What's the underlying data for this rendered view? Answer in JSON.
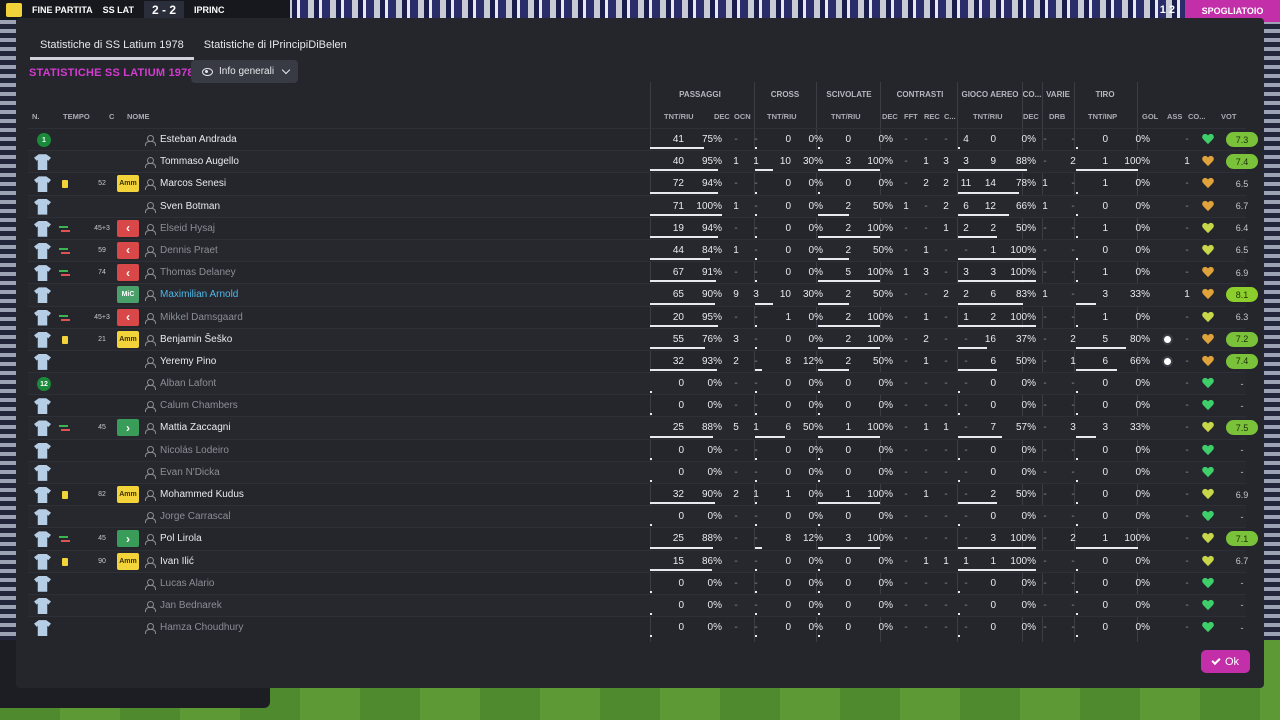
{
  "scorebar": {
    "label": "FINE PARTITA",
    "home": "SS LAT",
    "score": "2 - 2",
    "away": "IPRINC"
  },
  "top_right": {
    "label": "SPOGLIATOIO",
    "clock": "1 2"
  },
  "tabs": [
    {
      "label": "Statistiche di SS Latium 1978",
      "active": true
    },
    {
      "label": "Statistiche di IPrincipiDiBelen",
      "active": false
    }
  ],
  "title": "STATISTICHE SS LATIUM 1978",
  "view_dropdown": "Info generali",
  "groups": [
    "PASSAGGI",
    "CROSS",
    "SCIVOLATE",
    "CONTRASTI",
    "GIOCO AEREO",
    "CO...",
    "VARIE",
    "TIRO"
  ],
  "columns": [
    "N.",
    "TEMPO",
    "C",
    "NOME",
    "TNT/RIU",
    "DEC",
    "OCN",
    "TNT/RIU",
    "TNT/RIU",
    "DEC",
    "FFT",
    "REC",
    "C...",
    "TNT/RIU",
    "DEC",
    "DRB",
    "TNT/INP",
    "GOL",
    "ASS",
    "CO...",
    "VOT"
  ],
  "ok_label": "Ok",
  "players": [
    {
      "shirt": "gk",
      "num": "1",
      "card": "",
      "swap": "",
      "min": "",
      "badge": "",
      "name": "Esteban Andrada",
      "style": "",
      "p": [
        "41",
        "75%"
      ],
      "pbar": 75,
      "pdec": "-",
      "pocn": "-",
      "cr": [
        "0",
        "0%"
      ],
      "crbar": 0,
      "sc": [
        "0",
        "0%"
      ],
      "scbar": 0,
      "ct": [
        "-",
        "-",
        "-",
        "4"
      ],
      "ae": [
        "0",
        "0%"
      ],
      "aebar": 0,
      "co": "-",
      "drb": "-",
      "ti": [
        "0",
        "0%"
      ],
      "tibar": 0,
      "gol": "",
      "ass": "-",
      "mood": "hg",
      "vot": "7.3",
      "vstyle": "r-lime"
    },
    {
      "shirt": "out",
      "num": "",
      "card": "",
      "swap": "",
      "min": "",
      "badge": "",
      "name": "Tommaso Augello",
      "style": "",
      "p": [
        "40",
        "95%"
      ],
      "pbar": 95,
      "pdec": "1",
      "pocn": "1",
      "cr": [
        "10",
        "30%"
      ],
      "crbar": 30,
      "sc": [
        "3",
        "100%"
      ],
      "scbar": 100,
      "ct": [
        "-",
        "1",
        "3",
        "3"
      ],
      "ae": [
        "9",
        "88%"
      ],
      "aebar": 88,
      "co": "-",
      "drb": "2",
      "ti": [
        "1",
        "100%"
      ],
      "tibar": 100,
      "gol": "",
      "ass": "1",
      "mood": "ho",
      "vot": "7.4",
      "vstyle": "r-lime"
    },
    {
      "shirt": "out",
      "num": "",
      "card": "y",
      "swap": "",
      "min": "52",
      "badge": "Amm",
      "name": "Marcos Senesi",
      "style": "",
      "p": [
        "72",
        "94%"
      ],
      "pbar": 94,
      "pdec": "-",
      "pocn": "-",
      "cr": [
        "0",
        "0%"
      ],
      "crbar": 0,
      "sc": [
        "0",
        "0%"
      ],
      "scbar": 0,
      "ct": [
        "-",
        "2",
        "2",
        "11"
      ],
      "ae": [
        "14",
        "78%"
      ],
      "aebar": 78,
      "co": "1",
      "drb": "-",
      "ti": [
        "1",
        "0%"
      ],
      "tibar": 0,
      "gol": "",
      "ass": "-",
      "mood": "ho",
      "vot": "6.5",
      "vstyle": "r-plain"
    },
    {
      "shirt": "out",
      "num": "",
      "card": "",
      "swap": "",
      "min": "",
      "badge": "",
      "name": "Sven Botman",
      "style": "",
      "p": [
        "71",
        "100%"
      ],
      "pbar": 100,
      "pdec": "1",
      "pocn": "-",
      "cr": [
        "0",
        "0%"
      ],
      "crbar": 0,
      "sc": [
        "2",
        "50%"
      ],
      "scbar": 50,
      "ct": [
        "1",
        "-",
        "2",
        "6"
      ],
      "ae": [
        "12",
        "66%"
      ],
      "aebar": 66,
      "co": "1",
      "drb": "-",
      "ti": [
        "0",
        "0%"
      ],
      "tibar": 0,
      "gol": "",
      "ass": "-",
      "mood": "ho",
      "vot": "6.7",
      "vstyle": "r-plain"
    },
    {
      "shirt": "out",
      "num": "",
      "card": "",
      "swap": "out",
      "min": "45+3",
      "badge": "out",
      "name": "Elseid Hysaj",
      "style": "unused",
      "p": [
        "19",
        "94%"
      ],
      "pbar": 94,
      "pdec": "-",
      "pocn": "-",
      "cr": [
        "0",
        "0%"
      ],
      "crbar": 0,
      "sc": [
        "2",
        "100%"
      ],
      "scbar": 100,
      "ct": [
        "-",
        "-",
        "1",
        "2"
      ],
      "ae": [
        "2",
        "50%"
      ],
      "aebar": 50,
      "co": "-",
      "drb": "-",
      "ti": [
        "1",
        "0%"
      ],
      "tibar": 0,
      "gol": "",
      "ass": "-",
      "mood": "hy",
      "vot": "6.4",
      "vstyle": "r-plain"
    },
    {
      "shirt": "out",
      "num": "",
      "card": "",
      "swap": "out",
      "min": "59",
      "badge": "out",
      "name": "Dennis Praet",
      "style": "unused",
      "p": [
        "44",
        "84%"
      ],
      "pbar": 84,
      "pdec": "1",
      "pocn": "-",
      "cr": [
        "0",
        "0%"
      ],
      "crbar": 0,
      "sc": [
        "2",
        "50%"
      ],
      "scbar": 50,
      "ct": [
        "-",
        "1",
        "-",
        "-"
      ],
      "ae": [
        "1",
        "100%"
      ],
      "aebar": 100,
      "co": "-",
      "drb": "-",
      "ti": [
        "0",
        "0%"
      ],
      "tibar": 0,
      "gol": "",
      "ass": "-",
      "mood": "hy",
      "vot": "6.5",
      "vstyle": "r-plain"
    },
    {
      "shirt": "out",
      "num": "",
      "card": "",
      "swap": "out",
      "min": "74",
      "badge": "out",
      "name": "Thomas Delaney",
      "style": "unused",
      "p": [
        "67",
        "91%"
      ],
      "pbar": 91,
      "pdec": "-",
      "pocn": "-",
      "cr": [
        "0",
        "0%"
      ],
      "crbar": 0,
      "sc": [
        "5",
        "100%"
      ],
      "scbar": 100,
      "ct": [
        "1",
        "3",
        "-",
        "3"
      ],
      "ae": [
        "3",
        "100%"
      ],
      "aebar": 100,
      "co": "-",
      "drb": "-",
      "ti": [
        "1",
        "0%"
      ],
      "tibar": 0,
      "gol": "",
      "ass": "-",
      "mood": "ho",
      "vot": "6.9",
      "vstyle": "r-plain"
    },
    {
      "shirt": "out",
      "num": "",
      "card": "",
      "swap": "",
      "min": "",
      "badge": "MiC",
      "name": "Maximilian Arnold",
      "style": "hl",
      "p": [
        "65",
        "90%"
      ],
      "pbar": 90,
      "pdec": "9",
      "pocn": "3",
      "cr": [
        "10",
        "30%"
      ],
      "crbar": 30,
      "sc": [
        "2",
        "50%"
      ],
      "scbar": 50,
      "ct": [
        "-",
        "-",
        "2",
        "2"
      ],
      "ae": [
        "6",
        "83%"
      ],
      "aebar": 83,
      "co": "1",
      "drb": "-",
      "ti": [
        "3",
        "33%"
      ],
      "tibar": 33,
      "gol": "",
      "ass": "1",
      "mood": "ho",
      "vot": "8.1",
      "vstyle": "r-green"
    },
    {
      "shirt": "out",
      "num": "",
      "card": "",
      "swap": "out",
      "min": "45+3",
      "badge": "out",
      "name": "Mikkel Damsgaard",
      "style": "unused",
      "p": [
        "20",
        "95%"
      ],
      "pbar": 95,
      "pdec": "-",
      "pocn": "-",
      "cr": [
        "1",
        "0%"
      ],
      "crbar": 0,
      "sc": [
        "2",
        "100%"
      ],
      "scbar": 100,
      "ct": [
        "-",
        "1",
        "-",
        "1"
      ],
      "ae": [
        "2",
        "100%"
      ],
      "aebar": 100,
      "co": "-",
      "drb": "-",
      "ti": [
        "1",
        "0%"
      ],
      "tibar": 0,
      "gol": "",
      "ass": "-",
      "mood": "hy",
      "vot": "6.3",
      "vstyle": "r-plain"
    },
    {
      "shirt": "out",
      "num": "",
      "card": "y",
      "swap": "",
      "min": "21",
      "badge": "Amm",
      "name": "Benjamin Šeško",
      "style": "",
      "p": [
        "55",
        "76%"
      ],
      "pbar": 76,
      "pdec": "3",
      "pocn": "-",
      "cr": [
        "0",
        "0%"
      ],
      "crbar": 0,
      "sc": [
        "2",
        "100%"
      ],
      "scbar": 100,
      "ct": [
        "-",
        "2",
        "-",
        "-"
      ],
      "ae": [
        "16",
        "37%"
      ],
      "aebar": 37,
      "co": "-",
      "drb": "2",
      "ti": [
        "5",
        "80%"
      ],
      "tibar": 80,
      "gol": "ball",
      "ass": "-",
      "mood": "ho",
      "vot": "7.2",
      "vstyle": "r-lime"
    },
    {
      "shirt": "out",
      "num": "",
      "card": "",
      "swap": "",
      "min": "",
      "badge": "",
      "name": "Yeremy Pino",
      "style": "",
      "p": [
        "32",
        "93%"
      ],
      "pbar": 93,
      "pdec": "2",
      "pocn": "-",
      "cr": [
        "8",
        "12%"
      ],
      "crbar": 12,
      "sc": [
        "2",
        "50%"
      ],
      "scbar": 50,
      "ct": [
        "-",
        "1",
        "-",
        "-"
      ],
      "ae": [
        "6",
        "50%"
      ],
      "aebar": 50,
      "co": "-",
      "drb": "1",
      "ti": [
        "6",
        "66%"
      ],
      "tibar": 66,
      "gol": "ball",
      "ass": "-",
      "mood": "ho",
      "vot": "7.4",
      "vstyle": "r-lime"
    },
    {
      "shirt": "gk",
      "num": "12",
      "card": "",
      "swap": "",
      "min": "",
      "badge": "",
      "name": "Alban Lafont",
      "style": "unused",
      "p": [
        "0",
        "0%"
      ],
      "pbar": 0,
      "pdec": "-",
      "pocn": "-",
      "cr": [
        "0",
        "0%"
      ],
      "crbar": 0,
      "sc": [
        "0",
        "0%"
      ],
      "scbar": 0,
      "ct": [
        "-",
        "-",
        "-",
        "-"
      ],
      "ae": [
        "0",
        "0%"
      ],
      "aebar": 0,
      "co": "-",
      "drb": "-",
      "ti": [
        "0",
        "0%"
      ],
      "tibar": 0,
      "gol": "",
      "ass": "-",
      "mood": "hg",
      "vot": "-",
      "vstyle": "r-plain"
    },
    {
      "shirt": "out",
      "num": "",
      "card": "",
      "swap": "",
      "min": "",
      "badge": "",
      "name": "Calum Chambers",
      "style": "unused",
      "p": [
        "0",
        "0%"
      ],
      "pbar": 0,
      "pdec": "-",
      "pocn": "-",
      "cr": [
        "0",
        "0%"
      ],
      "crbar": 0,
      "sc": [
        "0",
        "0%"
      ],
      "scbar": 0,
      "ct": [
        "-",
        "-",
        "-",
        "-"
      ],
      "ae": [
        "0",
        "0%"
      ],
      "aebar": 0,
      "co": "-",
      "drb": "-",
      "ti": [
        "0",
        "0%"
      ],
      "tibar": 0,
      "gol": "",
      "ass": "-",
      "mood": "hg",
      "vot": "-",
      "vstyle": "r-plain"
    },
    {
      "shirt": "out",
      "num": "",
      "card": "",
      "swap": "in",
      "min": "45",
      "badge": "in",
      "name": "Mattia Zaccagni",
      "style": "",
      "p": [
        "25",
        "88%"
      ],
      "pbar": 88,
      "pdec": "5",
      "pocn": "1",
      "cr": [
        "6",
        "50%"
      ],
      "crbar": 50,
      "sc": [
        "1",
        "100%"
      ],
      "scbar": 100,
      "ct": [
        "-",
        "1",
        "1",
        "-"
      ],
      "ae": [
        "7",
        "57%"
      ],
      "aebar": 57,
      "co": "-",
      "drb": "3",
      "ti": [
        "3",
        "33%"
      ],
      "tibar": 33,
      "gol": "",
      "ass": "-",
      "mood": "hy",
      "vot": "7.5",
      "vstyle": "r-lime"
    },
    {
      "shirt": "out",
      "num": "",
      "card": "",
      "swap": "",
      "min": "",
      "badge": "",
      "name": "Nicolás Lodeiro",
      "style": "unused",
      "p": [
        "0",
        "0%"
      ],
      "pbar": 0,
      "pdec": "-",
      "pocn": "-",
      "cr": [
        "0",
        "0%"
      ],
      "crbar": 0,
      "sc": [
        "0",
        "0%"
      ],
      "scbar": 0,
      "ct": [
        "-",
        "-",
        "-",
        "-"
      ],
      "ae": [
        "0",
        "0%"
      ],
      "aebar": 0,
      "co": "-",
      "drb": "-",
      "ti": [
        "0",
        "0%"
      ],
      "tibar": 0,
      "gol": "",
      "ass": "-",
      "mood": "hg",
      "vot": "-",
      "vstyle": "r-plain"
    },
    {
      "shirt": "out",
      "num": "",
      "card": "",
      "swap": "",
      "min": "",
      "badge": "",
      "name": "Evan N'Dicka",
      "style": "unused",
      "p": [
        "0",
        "0%"
      ],
      "pbar": 0,
      "pdec": "-",
      "pocn": "-",
      "cr": [
        "0",
        "0%"
      ],
      "crbar": 0,
      "sc": [
        "0",
        "0%"
      ],
      "scbar": 0,
      "ct": [
        "-",
        "-",
        "-",
        "-"
      ],
      "ae": [
        "0",
        "0%"
      ],
      "aebar": 0,
      "co": "-",
      "drb": "-",
      "ti": [
        "0",
        "0%"
      ],
      "tibar": 0,
      "gol": "",
      "ass": "-",
      "mood": "hg",
      "vot": "-",
      "vstyle": "r-plain"
    },
    {
      "shirt": "out",
      "num": "",
      "card": "y",
      "swap": "",
      "min": "82",
      "badge": "Amm",
      "name": "Mohammed Kudus",
      "style": "",
      "p": [
        "32",
        "90%"
      ],
      "pbar": 90,
      "pdec": "2",
      "pocn": "1",
      "cr": [
        "1",
        "0%"
      ],
      "crbar": 0,
      "sc": [
        "1",
        "100%"
      ],
      "scbar": 100,
      "ct": [
        "-",
        "1",
        "-",
        "-"
      ],
      "ae": [
        "2",
        "50%"
      ],
      "aebar": 50,
      "co": "-",
      "drb": "-",
      "ti": [
        "0",
        "0%"
      ],
      "tibar": 0,
      "gol": "",
      "ass": "-",
      "mood": "hy",
      "vot": "6.9",
      "vstyle": "r-plain"
    },
    {
      "shirt": "out",
      "num": "",
      "card": "",
      "swap": "",
      "min": "",
      "badge": "",
      "name": "Jorge Carrascal",
      "style": "unused",
      "p": [
        "0",
        "0%"
      ],
      "pbar": 0,
      "pdec": "-",
      "pocn": "-",
      "cr": [
        "0",
        "0%"
      ],
      "crbar": 0,
      "sc": [
        "0",
        "0%"
      ],
      "scbar": 0,
      "ct": [
        "-",
        "-",
        "-",
        "-"
      ],
      "ae": [
        "0",
        "0%"
      ],
      "aebar": 0,
      "co": "-",
      "drb": "-",
      "ti": [
        "0",
        "0%"
      ],
      "tibar": 0,
      "gol": "",
      "ass": "-",
      "mood": "hg",
      "vot": "-",
      "vstyle": "r-plain"
    },
    {
      "shirt": "out",
      "num": "",
      "card": "",
      "swap": "in",
      "min": "45",
      "badge": "in",
      "name": "Pol Lirola",
      "style": "",
      "p": [
        "25",
        "88%"
      ],
      "pbar": 88,
      "pdec": "-",
      "pocn": "-",
      "cr": [
        "8",
        "12%"
      ],
      "crbar": 12,
      "sc": [
        "3",
        "100%"
      ],
      "scbar": 100,
      "ct": [
        "-",
        "-",
        "-",
        "-"
      ],
      "ae": [
        "3",
        "100%"
      ],
      "aebar": 100,
      "co": "-",
      "drb": "2",
      "ti": [
        "1",
        "100%"
      ],
      "tibar": 100,
      "gol": "",
      "ass": "-",
      "mood": "hy",
      "vot": "7.1",
      "vstyle": "r-lime"
    },
    {
      "shirt": "out",
      "num": "",
      "card": "y",
      "swap": "",
      "min": "90",
      "badge": "Amm",
      "name": "Ivan Ilić",
      "style": "",
      "p": [
        "15",
        "86%"
      ],
      "pbar": 86,
      "pdec": "-",
      "pocn": "-",
      "cr": [
        "0",
        "0%"
      ],
      "crbar": 0,
      "sc": [
        "0",
        "0%"
      ],
      "scbar": 0,
      "ct": [
        "-",
        "1",
        "1",
        "1"
      ],
      "ae": [
        "1",
        "100%"
      ],
      "aebar": 100,
      "co": "-",
      "drb": "-",
      "ti": [
        "0",
        "0%"
      ],
      "tibar": 0,
      "gol": "",
      "ass": "-",
      "mood": "hy",
      "vot": "6.7",
      "vstyle": "r-plain"
    },
    {
      "shirt": "out",
      "num": "",
      "card": "",
      "swap": "",
      "min": "",
      "badge": "",
      "name": "Lucas Alario",
      "style": "unused",
      "p": [
        "0",
        "0%"
      ],
      "pbar": 0,
      "pdec": "-",
      "pocn": "-",
      "cr": [
        "0",
        "0%"
      ],
      "crbar": 0,
      "sc": [
        "0",
        "0%"
      ],
      "scbar": 0,
      "ct": [
        "-",
        "-",
        "-",
        "-"
      ],
      "ae": [
        "0",
        "0%"
      ],
      "aebar": 0,
      "co": "-",
      "drb": "-",
      "ti": [
        "0",
        "0%"
      ],
      "tibar": 0,
      "gol": "",
      "ass": "-",
      "mood": "hg",
      "vot": "-",
      "vstyle": "r-plain"
    },
    {
      "shirt": "out",
      "num": "",
      "card": "",
      "swap": "",
      "min": "",
      "badge": "",
      "name": "Jan Bednarek",
      "style": "unused",
      "p": [
        "0",
        "0%"
      ],
      "pbar": 0,
      "pdec": "-",
      "pocn": "-",
      "cr": [
        "0",
        "0%"
      ],
      "crbar": 0,
      "sc": [
        "0",
        "0%"
      ],
      "scbar": 0,
      "ct": [
        "-",
        "-",
        "-",
        "-"
      ],
      "ae": [
        "0",
        "0%"
      ],
      "aebar": 0,
      "co": "-",
      "drb": "-",
      "ti": [
        "0",
        "0%"
      ],
      "tibar": 0,
      "gol": "",
      "ass": "-",
      "mood": "hg",
      "vot": "-",
      "vstyle": "r-plain"
    },
    {
      "shirt": "out",
      "num": "",
      "card": "",
      "swap": "",
      "min": "",
      "badge": "",
      "name": "Hamza Choudhury",
      "style": "unused",
      "p": [
        "0",
        "0%"
      ],
      "pbar": 0,
      "pdec": "-",
      "pocn": "-",
      "cr": [
        "0",
        "0%"
      ],
      "crbar": 0,
      "sc": [
        "0",
        "0%"
      ],
      "scbar": 0,
      "ct": [
        "-",
        "-",
        "-",
        "-"
      ],
      "ae": [
        "0",
        "0%"
      ],
      "aebar": 0,
      "co": "-",
      "drb": "-",
      "ti": [
        "0",
        "0%"
      ],
      "tibar": 0,
      "gol": "",
      "ass": "-",
      "mood": "hg",
      "vot": "-",
      "vstyle": "r-plain"
    }
  ]
}
